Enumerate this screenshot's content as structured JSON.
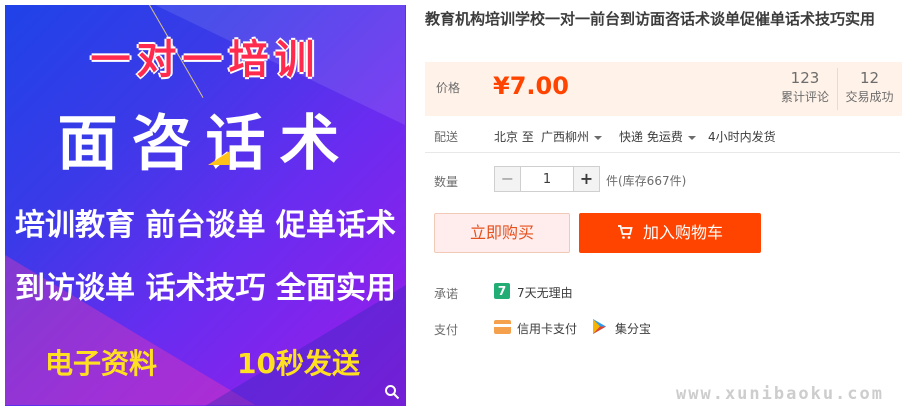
{
  "image": {
    "title": "一对一培训",
    "headline": "面咨话术",
    "line1": "培训教育 前台谈单 促单话术",
    "line2": "到访谈单 话术技巧 全面实用",
    "bottom_left": "电子资料",
    "bottom_right": "10秒发送",
    "colors": {
      "bg_start": "#1f43e8",
      "bg_end": "#9d1be8",
      "title": "#ff2a4d",
      "bottom": "#ffe021"
    },
    "zoom_icon": "magnifier-icon"
  },
  "product": {
    "title": "教育机构培训学校一对一前台到访面咨话术谈单促催单话术技巧实用"
  },
  "price": {
    "label": "价格",
    "value": "¥7.00",
    "reviews_count": "123",
    "reviews_label": "累计评论",
    "trades_count": "12",
    "trades_label": "交易成功"
  },
  "shipping": {
    "label": "配送",
    "from": "北京 至",
    "to": "广西柳州",
    "method": "快递 免运费",
    "time": "4小时内发货"
  },
  "quantity": {
    "label": "数量",
    "minus": "−",
    "value": "1",
    "plus": "+",
    "stock": "件(库存667件)"
  },
  "actions": {
    "buy_now": "立即购买",
    "add_to_cart": "加入购物车"
  },
  "promise": {
    "label": "承诺",
    "icon_text": "7",
    "text": "7天无理由"
  },
  "payment": {
    "label": "支付",
    "credit_card": "信用卡支付",
    "jifenbao": "集分宝"
  },
  "watermark": "www.xunibaoku.com"
}
